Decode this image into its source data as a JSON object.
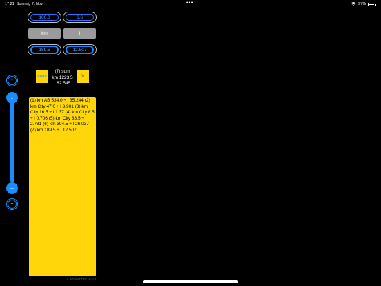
{
  "status": {
    "time": "17:21",
    "date": "Sonntag 7. Nov.",
    "dots": "•••",
    "wifi": "wifi-icon",
    "battery_pct": "97%"
  },
  "inputs": {
    "km_value": "100.0",
    "l_value": "6.6",
    "km_label": "km",
    "l_label": "l",
    "km_total": "189.5",
    "l_total": "12.507"
  },
  "controls": {
    "minus_small": "-",
    "minus": "-",
    "plus": "+",
    "plus_small": "+"
  },
  "memory": {
    "mem_label": "mem",
    "clear_label": "X",
    "sum_title": "(7) sum",
    "sum_km": "km 1223.5",
    "sum_l": "l 82.545"
  },
  "notes": {
    "text": "(1) km AB 534.0 ÷ l 35.244 (2) km City 47.0 ÷ l 3.901 (3) km City 16.5 ÷ l 1.37 (4) km City 8.5 ÷ l 0.706 (5) km City 33.5 ÷ l 2.781 (6) km 394.5 ÷ l 26.037 (7) km 189.5 ÷ l 12.507"
  },
  "footer": {
    "date": "7 November 2021"
  },
  "colors": {
    "accent": "#1a8cff",
    "note_yellow": "#ffd60a",
    "unit_gray": "#9b9b9b"
  }
}
